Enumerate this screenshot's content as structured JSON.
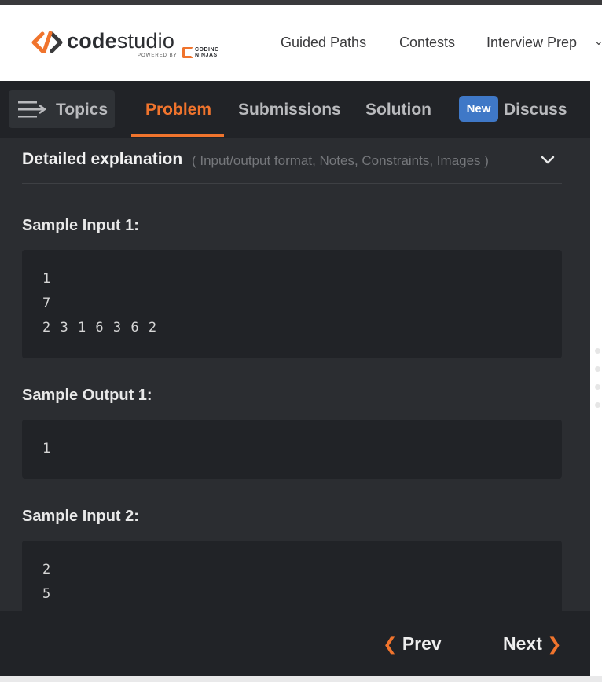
{
  "header": {
    "logo_code": "code",
    "logo_studio": "studio",
    "logo_powered": "POWERED BY",
    "logo_coding": "CODING",
    "logo_ninjas": "NINJAS",
    "nav": [
      "Guided Paths",
      "Contests",
      "Interview Prep"
    ]
  },
  "tabs": {
    "topics": "Topics",
    "problem": "Problem",
    "submissions": "Submissions",
    "solution": "Solution",
    "new_badge": "New",
    "discuss": "Discuss"
  },
  "detail": {
    "title": "Detailed explanation",
    "subtitle": "( Input/output format, Notes, Constraints, Images )"
  },
  "samples": [
    {
      "label": "Sample Input 1:",
      "lines": [
        "1",
        "7",
        "2 3 1 6 3 6 2"
      ]
    },
    {
      "label": "Sample Output 1:",
      "lines": [
        "1"
      ]
    },
    {
      "label": "Sample Input 2:",
      "lines": [
        "2",
        "5"
      ]
    }
  ],
  "footer": {
    "prev": "Prev",
    "next": "Next"
  },
  "colors": {
    "accent": "#f0742d",
    "badge": "#3f78c7",
    "panel": "#2b2d31",
    "code_bg": "#212327"
  }
}
